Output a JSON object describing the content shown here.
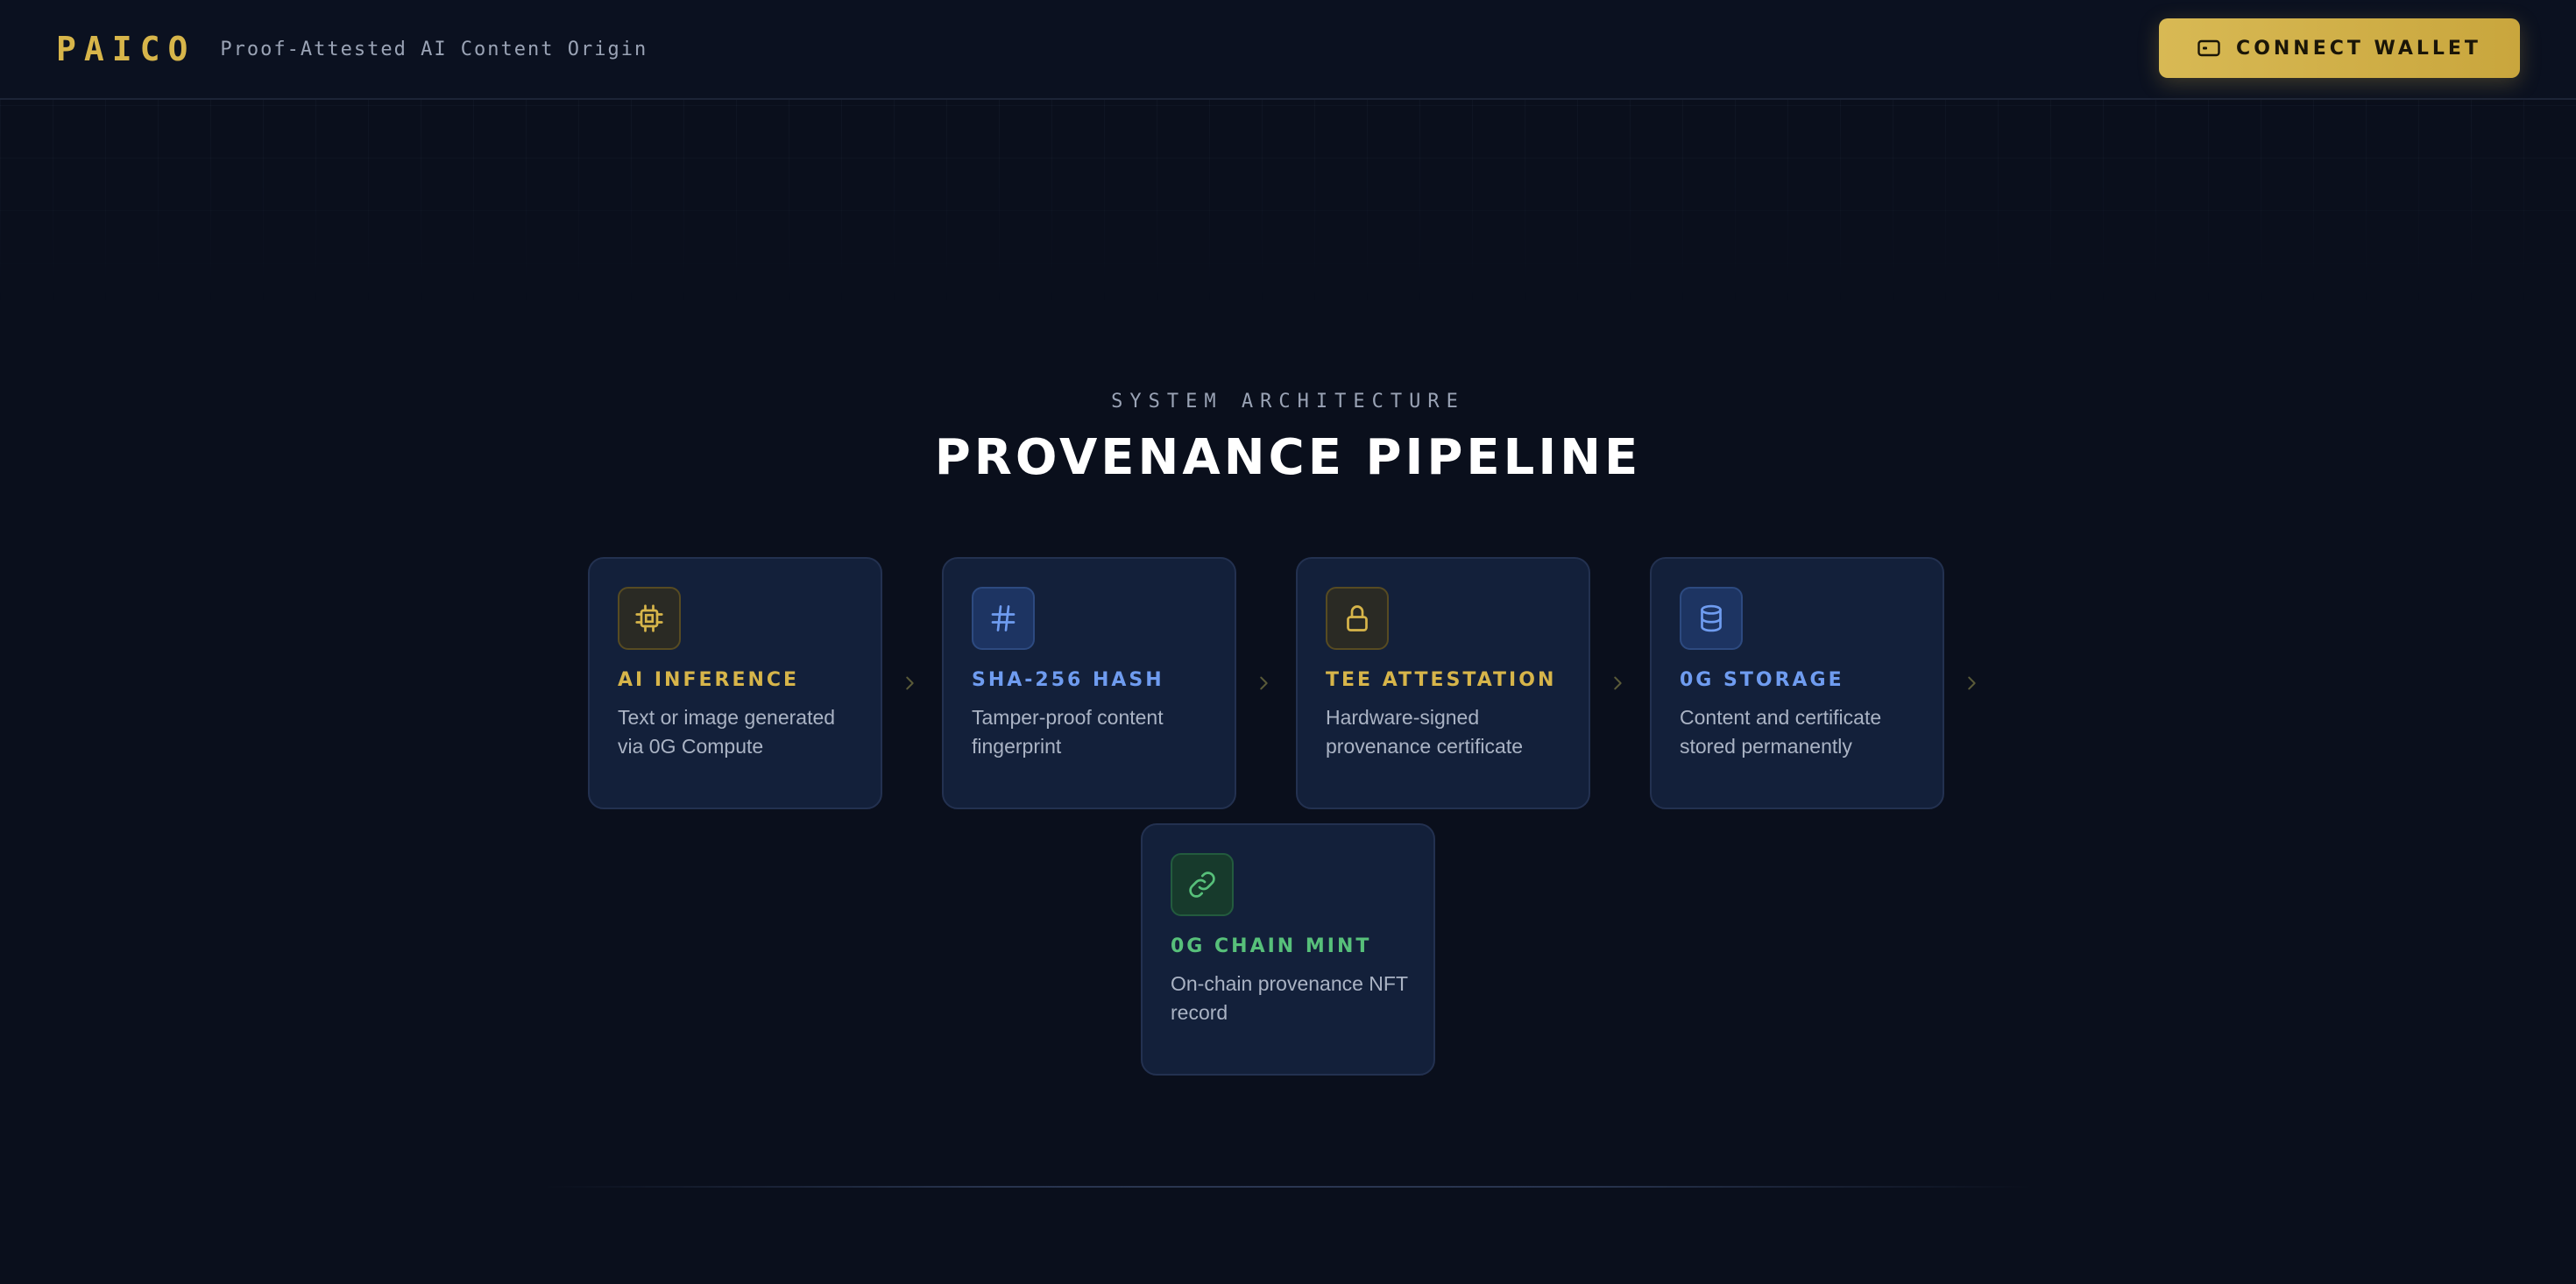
{
  "header": {
    "logo": "PAICO",
    "tagline": "Proof-Attested AI Content Origin",
    "connect_label": "CONNECT WALLET"
  },
  "section": {
    "eyebrow": "SYSTEM ARCHITECTURE",
    "title": "PROVENANCE PIPELINE"
  },
  "steps": [
    {
      "title": "AI INFERENCE",
      "desc": "Text or image generated via 0G Compute",
      "icon": "cpu-icon",
      "accent": "#d7b54a"
    },
    {
      "title": "SHA-256 HASH",
      "desc": "Tamper-proof content fingerprint",
      "icon": "hash-icon",
      "accent": "#6f9cf0"
    },
    {
      "title": "TEE ATTESTATION",
      "desc": "Hardware-signed provenance certificate",
      "icon": "lock-icon",
      "accent": "#d7b54a"
    },
    {
      "title": "0G STORAGE",
      "desc": "Content and certificate stored permanently",
      "icon": "database-icon",
      "accent": "#6f9cf0"
    },
    {
      "title": "0G CHAIN MINT",
      "desc": "On-chain provenance NFT record",
      "icon": "link-icon",
      "accent": "#57c07a"
    }
  ],
  "colors": {
    "background": "#0a0f1c",
    "card": "#13203a",
    "gold": "#d7b54a",
    "blue": "#6f9cf0",
    "green": "#57c07a"
  }
}
